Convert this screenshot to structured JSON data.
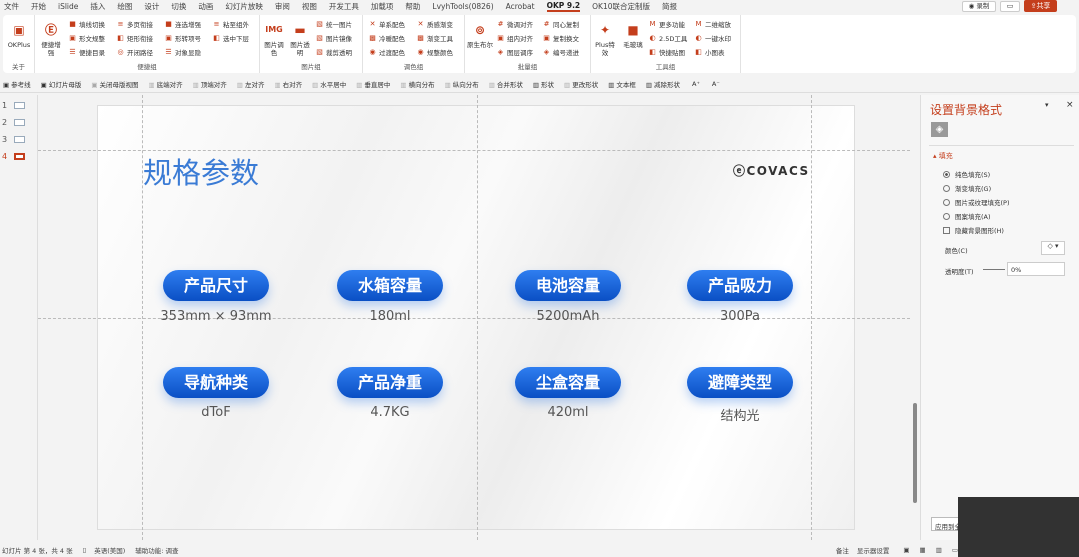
{
  "tabs": [
    "文件",
    "开始",
    "iSlide",
    "插入",
    "绘图",
    "设计",
    "切换",
    "动画",
    "幻灯片放映",
    "审阅",
    "视图",
    "开发工具",
    "加载项",
    "帮助",
    "LvyhTools(0826)",
    "Acrobat",
    "OKP 9.2",
    "OK10联合定制版",
    "简报"
  ],
  "active_tab": "OKP 9.2",
  "top_right": {
    "record": "录制",
    "share": "共享"
  },
  "ribbon": {
    "about": {
      "btn": "OKPlus",
      "label": "关于"
    },
    "quick": {
      "big": "便捷增强",
      "items": [
        "填线切换",
        "形文规整",
        "便捷目录",
        "多页衔接",
        "矩形衔接",
        "开闭路径",
        "连选增强",
        "形转项号",
        "对象显隐",
        "粘至组外",
        "选中下层"
      ],
      "label": "便捷组"
    },
    "image": {
      "big1": "图片调色",
      "big2": "图片透明",
      "items": [
        "统一图片",
        "图片镜像",
        "裁剪透明"
      ],
      "label": "图片组"
    },
    "color": {
      "items": [
        "单系配色",
        "冷暖配色",
        "过渡配色",
        "质感渐变",
        "渐变工具",
        "规整颜色"
      ],
      "label": "调色组"
    },
    "batch": {
      "big": "原生布尔",
      "items": [
        "微调对齐",
        "组内对齐",
        "图层调序",
        "同心复制",
        "复制换文",
        "编号递进"
      ],
      "label": "批量组"
    },
    "tools": {
      "big1": "Plus特效",
      "big2": "毛玻璃",
      "items": [
        "更多功能",
        "2.5D工具",
        "快捷贴图",
        "二维缩放",
        "一键水印",
        "小图表"
      ],
      "label": "工具组"
    }
  },
  "toolbar2": [
    {
      "t": "参考线",
      "d": false
    },
    {
      "t": "幻灯片母版",
      "d": false
    },
    {
      "t": "关闭母版视图",
      "d": true
    },
    {
      "t": "底端对齐",
      "d": true
    },
    {
      "t": "顶端对齐",
      "d": true
    },
    {
      "t": "左对齐",
      "d": true
    },
    {
      "t": "右对齐",
      "d": true
    },
    {
      "t": "水平居中",
      "d": true
    },
    {
      "t": "垂直居中",
      "d": true
    },
    {
      "t": "横向分布",
      "d": true
    },
    {
      "t": "纵向分布",
      "d": true
    },
    {
      "t": "合并形状",
      "d": true
    },
    {
      "t": "形状",
      "d": false
    },
    {
      "t": "更改形状",
      "d": true
    },
    {
      "t": "文本框",
      "d": false
    },
    {
      "t": "减除形状",
      "d": false
    },
    {
      "t": "A⁺",
      "d": false
    },
    {
      "t": "A⁻",
      "d": false
    }
  ],
  "thumbs": [
    "1",
    "2",
    "3",
    "4"
  ],
  "current_slide": "4",
  "slide": {
    "title": "规格参数",
    "logo": "ECOVACS",
    "specs": [
      {
        "k": "产品尺寸",
        "v": "353mm × 93mm"
      },
      {
        "k": "水箱容量",
        "v": "180ml"
      },
      {
        "k": "电池容量",
        "v": "5200mAh"
      },
      {
        "k": "产品吸力",
        "v": "300Pa"
      },
      {
        "k": "导航种类",
        "v": "dToF"
      },
      {
        "k": "产品净重",
        "v": "4.7KG"
      },
      {
        "k": "尘盒容量",
        "v": "420ml"
      },
      {
        "k": "避障类型",
        "v": "结构光"
      }
    ]
  },
  "pane": {
    "title": "设置背景格式",
    "section": "填充",
    "options": [
      "纯色填充(S)",
      "渐变填充(G)",
      "图片或纹理填充(P)",
      "图案填充(A)"
    ],
    "selected": "纯色填充(S)",
    "checkbox": "隐藏背景图形(H)",
    "color_label": "颜色(C)",
    "transparency_label": "透明度(T)",
    "transparency": "0%",
    "apply": "应用到全部"
  },
  "status": {
    "slide": "幻灯片 第 4 张，共 4 张",
    "lang": "英语(美国)",
    "access": "辅助功能: 调查",
    "notes": "备注",
    "display": "显示器设置"
  },
  "colors": {
    "accent": "#c43e1c",
    "pill": "#1261d6",
    "title": "#3a7bd5"
  }
}
